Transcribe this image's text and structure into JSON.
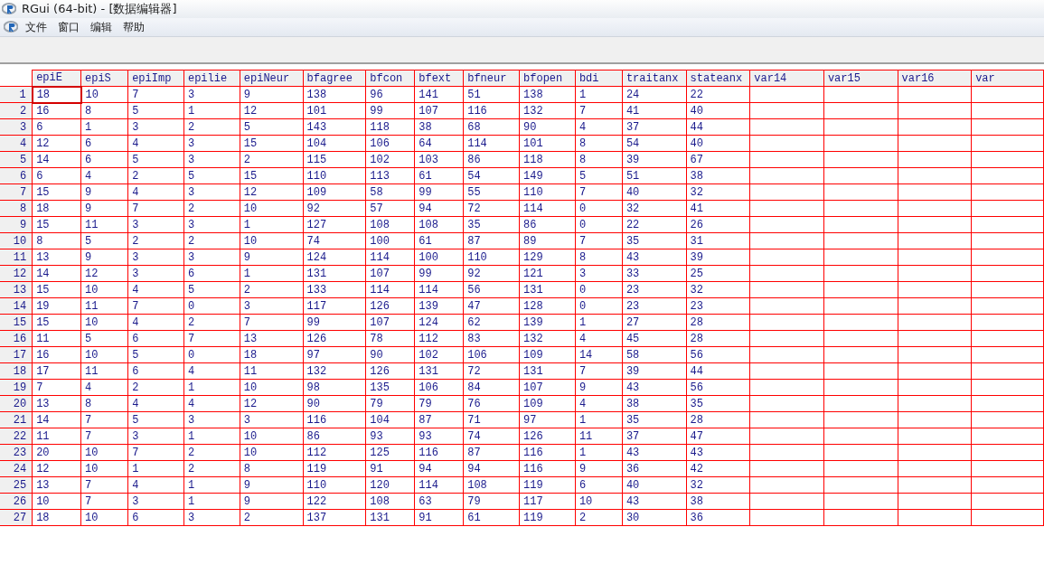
{
  "window": {
    "title": "RGui (64-bit) - [数据编辑器]"
  },
  "menu": [
    "文件",
    "窗口",
    "编辑",
    "帮助"
  ],
  "grid": {
    "columns": [
      "epiE",
      "epiS",
      "epiImp",
      "epilie",
      "epiNeur",
      "bfagree",
      "bfcon",
      "bfext",
      "bfneur",
      "bfopen",
      "bdi",
      "traitanx",
      "stateanx",
      "var14",
      "var15",
      "var16",
      "var"
    ],
    "rows": [
      {
        "label": "1",
        "cells": [
          {
            "value": "18",
            "selected": true
          },
          {
            "value": "10",
            "selected": false
          },
          {
            "value": "7",
            "selected": false
          },
          {
            "value": "3",
            "selected": false
          },
          {
            "value": "9",
            "selected": false
          },
          {
            "value": "138",
            "selected": false
          },
          {
            "value": "96",
            "selected": false
          },
          {
            "value": "141",
            "selected": false
          },
          {
            "value": "51",
            "selected": false
          },
          {
            "value": "138",
            "selected": false
          },
          {
            "value": "1",
            "selected": false
          },
          {
            "value": "24",
            "selected": false
          },
          {
            "value": "22",
            "selected": false
          }
        ]
      },
      {
        "label": "2",
        "cells": [
          {
            "value": "16",
            "selected": false
          },
          {
            "value": "8",
            "selected": false
          },
          {
            "value": "5",
            "selected": false
          },
          {
            "value": "1",
            "selected": false
          },
          {
            "value": "12",
            "selected": false
          },
          {
            "value": "101",
            "selected": false
          },
          {
            "value": "99",
            "selected": false
          },
          {
            "value": "107",
            "selected": false
          },
          {
            "value": "116",
            "selected": false
          },
          {
            "value": "132",
            "selected": false
          },
          {
            "value": "7",
            "selected": false
          },
          {
            "value": "41",
            "selected": false
          },
          {
            "value": "40",
            "selected": false
          }
        ]
      },
      {
        "label": "3",
        "cells": [
          {
            "value": "6",
            "selected": false
          },
          {
            "value": "1",
            "selected": false
          },
          {
            "value": "3",
            "selected": false
          },
          {
            "value": "2",
            "selected": false
          },
          {
            "value": "5",
            "selected": false
          },
          {
            "value": "143",
            "selected": false
          },
          {
            "value": "118",
            "selected": false
          },
          {
            "value": "38",
            "selected": false
          },
          {
            "value": "68",
            "selected": false
          },
          {
            "value": "90",
            "selected": false
          },
          {
            "value": "4",
            "selected": false
          },
          {
            "value": "37",
            "selected": false
          },
          {
            "value": "44",
            "selected": false
          }
        ]
      },
      {
        "label": "4",
        "cells": [
          {
            "value": "12",
            "selected": false
          },
          {
            "value": "6",
            "selected": false
          },
          {
            "value": "4",
            "selected": false
          },
          {
            "value": "3",
            "selected": false
          },
          {
            "value": "15",
            "selected": false
          },
          {
            "value": "104",
            "selected": false
          },
          {
            "value": "106",
            "selected": false
          },
          {
            "value": "64",
            "selected": false
          },
          {
            "value": "114",
            "selected": false
          },
          {
            "value": "101",
            "selected": false
          },
          {
            "value": "8",
            "selected": false
          },
          {
            "value": "54",
            "selected": false
          },
          {
            "value": "40",
            "selected": false
          }
        ]
      },
      {
        "label": "5",
        "cells": [
          {
            "value": "14",
            "selected": false
          },
          {
            "value": "6",
            "selected": false
          },
          {
            "value": "5",
            "selected": false
          },
          {
            "value": "3",
            "selected": false
          },
          {
            "value": "2",
            "selected": false
          },
          {
            "value": "115",
            "selected": false
          },
          {
            "value": "102",
            "selected": false
          },
          {
            "value": "103",
            "selected": false
          },
          {
            "value": "86",
            "selected": false
          },
          {
            "value": "118",
            "selected": false
          },
          {
            "value": "8",
            "selected": false
          },
          {
            "value": "39",
            "selected": false
          },
          {
            "value": "67",
            "selected": false
          }
        ]
      },
      {
        "label": "6",
        "cells": [
          {
            "value": "6",
            "selected": false
          },
          {
            "value": "4",
            "selected": false
          },
          {
            "value": "2",
            "selected": false
          },
          {
            "value": "5",
            "selected": false
          },
          {
            "value": "15",
            "selected": false
          },
          {
            "value": "110",
            "selected": false
          },
          {
            "value": "113",
            "selected": false
          },
          {
            "value": "61",
            "selected": false
          },
          {
            "value": "54",
            "selected": false
          },
          {
            "value": "149",
            "selected": false
          },
          {
            "value": "5",
            "selected": false
          },
          {
            "value": "51",
            "selected": false
          },
          {
            "value": "38",
            "selected": false
          }
        ]
      },
      {
        "label": "7",
        "cells": [
          {
            "value": "15",
            "selected": false
          },
          {
            "value": "9",
            "selected": false
          },
          {
            "value": "4",
            "selected": false
          },
          {
            "value": "3",
            "selected": false
          },
          {
            "value": "12",
            "selected": false
          },
          {
            "value": "109",
            "selected": false
          },
          {
            "value": "58",
            "selected": false
          },
          {
            "value": "99",
            "selected": false
          },
          {
            "value": "55",
            "selected": false
          },
          {
            "value": "110",
            "selected": false
          },
          {
            "value": "7",
            "selected": false
          },
          {
            "value": "40",
            "selected": false
          },
          {
            "value": "32",
            "selected": false
          }
        ]
      },
      {
        "label": "8",
        "cells": [
          {
            "value": "18",
            "selected": false
          },
          {
            "value": "9",
            "selected": false
          },
          {
            "value": "7",
            "selected": false
          },
          {
            "value": "2",
            "selected": false
          },
          {
            "value": "10",
            "selected": false
          },
          {
            "value": "92",
            "selected": false
          },
          {
            "value": "57",
            "selected": false
          },
          {
            "value": "94",
            "selected": false
          },
          {
            "value": "72",
            "selected": false
          },
          {
            "value": "114",
            "selected": false
          },
          {
            "value": "0",
            "selected": false
          },
          {
            "value": "32",
            "selected": false
          },
          {
            "value": "41",
            "selected": false
          }
        ]
      },
      {
        "label": "9",
        "cells": [
          {
            "value": "15",
            "selected": false
          },
          {
            "value": "11",
            "selected": false
          },
          {
            "value": "3",
            "selected": false
          },
          {
            "value": "3",
            "selected": false
          },
          {
            "value": "1",
            "selected": false
          },
          {
            "value": "127",
            "selected": false
          },
          {
            "value": "108",
            "selected": false
          },
          {
            "value": "108",
            "selected": false
          },
          {
            "value": "35",
            "selected": false
          },
          {
            "value": "86",
            "selected": false
          },
          {
            "value": "0",
            "selected": false
          },
          {
            "value": "22",
            "selected": false
          },
          {
            "value": "26",
            "selected": false
          }
        ]
      },
      {
        "label": "10",
        "cells": [
          {
            "value": "8",
            "selected": false
          },
          {
            "value": "5",
            "selected": false
          },
          {
            "value": "2",
            "selected": false
          },
          {
            "value": "2",
            "selected": false
          },
          {
            "value": "10",
            "selected": false
          },
          {
            "value": "74",
            "selected": false
          },
          {
            "value": "100",
            "selected": false
          },
          {
            "value": "61",
            "selected": false
          },
          {
            "value": "87",
            "selected": false
          },
          {
            "value": "89",
            "selected": false
          },
          {
            "value": "7",
            "selected": false
          },
          {
            "value": "35",
            "selected": false
          },
          {
            "value": "31",
            "selected": false
          }
        ]
      },
      {
        "label": "11",
        "cells": [
          {
            "value": "13",
            "selected": false
          },
          {
            "value": "9",
            "selected": false
          },
          {
            "value": "3",
            "selected": false
          },
          {
            "value": "3",
            "selected": false
          },
          {
            "value": "9",
            "selected": false
          },
          {
            "value": "124",
            "selected": false
          },
          {
            "value": "114",
            "selected": false
          },
          {
            "value": "100",
            "selected": false
          },
          {
            "value": "110",
            "selected": false
          },
          {
            "value": "129",
            "selected": false
          },
          {
            "value": "8",
            "selected": false
          },
          {
            "value": "43",
            "selected": false
          },
          {
            "value": "39",
            "selected": false
          }
        ]
      },
      {
        "label": "12",
        "cells": [
          {
            "value": "14",
            "selected": false
          },
          {
            "value": "12",
            "selected": false
          },
          {
            "value": "3",
            "selected": false
          },
          {
            "value": "6",
            "selected": false
          },
          {
            "value": "1",
            "selected": false
          },
          {
            "value": "131",
            "selected": false
          },
          {
            "value": "107",
            "selected": false
          },
          {
            "value": "99",
            "selected": false
          },
          {
            "value": "92",
            "selected": false
          },
          {
            "value": "121",
            "selected": false
          },
          {
            "value": "3",
            "selected": false
          },
          {
            "value": "33",
            "selected": false
          },
          {
            "value": "25",
            "selected": false
          }
        ]
      },
      {
        "label": "13",
        "cells": [
          {
            "value": "15",
            "selected": false
          },
          {
            "value": "10",
            "selected": false
          },
          {
            "value": "4",
            "selected": false
          },
          {
            "value": "5",
            "selected": false
          },
          {
            "value": "2",
            "selected": false
          },
          {
            "value": "133",
            "selected": false
          },
          {
            "value": "114",
            "selected": false
          },
          {
            "value": "114",
            "selected": false
          },
          {
            "value": "56",
            "selected": false
          },
          {
            "value": "131",
            "selected": false
          },
          {
            "value": "0",
            "selected": false
          },
          {
            "value": "23",
            "selected": false
          },
          {
            "value": "32",
            "selected": false
          }
        ]
      },
      {
        "label": "14",
        "cells": [
          {
            "value": "19",
            "selected": false
          },
          {
            "value": "11",
            "selected": false
          },
          {
            "value": "7",
            "selected": false
          },
          {
            "value": "0",
            "selected": false
          },
          {
            "value": "3",
            "selected": false
          },
          {
            "value": "117",
            "selected": false
          },
          {
            "value": "126",
            "selected": false
          },
          {
            "value": "139",
            "selected": false
          },
          {
            "value": "47",
            "selected": false
          },
          {
            "value": "128",
            "selected": false
          },
          {
            "value": "0",
            "selected": false
          },
          {
            "value": "23",
            "selected": false
          },
          {
            "value": "23",
            "selected": false
          }
        ]
      },
      {
        "label": "15",
        "cells": [
          {
            "value": "15",
            "selected": false
          },
          {
            "value": "10",
            "selected": false
          },
          {
            "value": "4",
            "selected": false
          },
          {
            "value": "2",
            "selected": false
          },
          {
            "value": "7",
            "selected": false
          },
          {
            "value": "99",
            "selected": false
          },
          {
            "value": "107",
            "selected": false
          },
          {
            "value": "124",
            "selected": false
          },
          {
            "value": "62",
            "selected": false
          },
          {
            "value": "139",
            "selected": false
          },
          {
            "value": "1",
            "selected": false
          },
          {
            "value": "27",
            "selected": false
          },
          {
            "value": "28",
            "selected": false
          }
        ]
      },
      {
        "label": "16",
        "cells": [
          {
            "value": "11",
            "selected": false
          },
          {
            "value": "5",
            "selected": false
          },
          {
            "value": "6",
            "selected": false
          },
          {
            "value": "7",
            "selected": false
          },
          {
            "value": "13",
            "selected": false
          },
          {
            "value": "126",
            "selected": false
          },
          {
            "value": "78",
            "selected": false
          },
          {
            "value": "112",
            "selected": false
          },
          {
            "value": "83",
            "selected": false
          },
          {
            "value": "132",
            "selected": false
          },
          {
            "value": "4",
            "selected": false
          },
          {
            "value": "45",
            "selected": false
          },
          {
            "value": "28",
            "selected": false
          }
        ]
      },
      {
        "label": "17",
        "cells": [
          {
            "value": "16",
            "selected": false
          },
          {
            "value": "10",
            "selected": false
          },
          {
            "value": "5",
            "selected": false
          },
          {
            "value": "0",
            "selected": false
          },
          {
            "value": "18",
            "selected": false
          },
          {
            "value": "97",
            "selected": false
          },
          {
            "value": "90",
            "selected": false
          },
          {
            "value": "102",
            "selected": false
          },
          {
            "value": "106",
            "selected": false
          },
          {
            "value": "109",
            "selected": false
          },
          {
            "value": "14",
            "selected": false
          },
          {
            "value": "58",
            "selected": false
          },
          {
            "value": "56",
            "selected": false
          }
        ]
      },
      {
        "label": "18",
        "cells": [
          {
            "value": "17",
            "selected": false
          },
          {
            "value": "11",
            "selected": false
          },
          {
            "value": "6",
            "selected": false
          },
          {
            "value": "4",
            "selected": false
          },
          {
            "value": "11",
            "selected": false
          },
          {
            "value": "132",
            "selected": false
          },
          {
            "value": "126",
            "selected": false
          },
          {
            "value": "131",
            "selected": false
          },
          {
            "value": "72",
            "selected": false
          },
          {
            "value": "131",
            "selected": false
          },
          {
            "value": "7",
            "selected": false
          },
          {
            "value": "39",
            "selected": false
          },
          {
            "value": "44",
            "selected": false
          }
        ]
      },
      {
        "label": "19",
        "cells": [
          {
            "value": "7",
            "selected": false
          },
          {
            "value": "4",
            "selected": false
          },
          {
            "value": "2",
            "selected": false
          },
          {
            "value": "1",
            "selected": false
          },
          {
            "value": "10",
            "selected": false
          },
          {
            "value": "98",
            "selected": false
          },
          {
            "value": "135",
            "selected": false
          },
          {
            "value": "106",
            "selected": false
          },
          {
            "value": "84",
            "selected": false
          },
          {
            "value": "107",
            "selected": false
          },
          {
            "value": "9",
            "selected": false
          },
          {
            "value": "43",
            "selected": false
          },
          {
            "value": "56",
            "selected": false
          }
        ]
      },
      {
        "label": "20",
        "cells": [
          {
            "value": "13",
            "selected": false
          },
          {
            "value": "8",
            "selected": false
          },
          {
            "value": "4",
            "selected": false
          },
          {
            "value": "4",
            "selected": false
          },
          {
            "value": "12",
            "selected": false
          },
          {
            "value": "90",
            "selected": false
          },
          {
            "value": "79",
            "selected": false
          },
          {
            "value": "79",
            "selected": false
          },
          {
            "value": "76",
            "selected": false
          },
          {
            "value": "109",
            "selected": false
          },
          {
            "value": "4",
            "selected": false
          },
          {
            "value": "38",
            "selected": false
          },
          {
            "value": "35",
            "selected": false
          }
        ]
      },
      {
        "label": "21",
        "cells": [
          {
            "value": "14",
            "selected": false
          },
          {
            "value": "7",
            "selected": false
          },
          {
            "value": "5",
            "selected": false
          },
          {
            "value": "3",
            "selected": false
          },
          {
            "value": "3",
            "selected": false
          },
          {
            "value": "116",
            "selected": false
          },
          {
            "value": "104",
            "selected": false
          },
          {
            "value": "87",
            "selected": false
          },
          {
            "value": "71",
            "selected": false
          },
          {
            "value": "97",
            "selected": false
          },
          {
            "value": "1",
            "selected": false
          },
          {
            "value": "35",
            "selected": false
          },
          {
            "value": "28",
            "selected": false
          }
        ]
      },
      {
        "label": "22",
        "cells": [
          {
            "value": "11",
            "selected": false
          },
          {
            "value": "7",
            "selected": false
          },
          {
            "value": "3",
            "selected": false
          },
          {
            "value": "1",
            "selected": false
          },
          {
            "value": "10",
            "selected": false
          },
          {
            "value": "86",
            "selected": false
          },
          {
            "value": "93",
            "selected": false
          },
          {
            "value": "93",
            "selected": false
          },
          {
            "value": "74",
            "selected": false
          },
          {
            "value": "126",
            "selected": false
          },
          {
            "value": "11",
            "selected": false
          },
          {
            "value": "37",
            "selected": false
          },
          {
            "value": "47",
            "selected": false
          }
        ]
      },
      {
        "label": "23",
        "cells": [
          {
            "value": "20",
            "selected": false
          },
          {
            "value": "10",
            "selected": false
          },
          {
            "value": "7",
            "selected": false
          },
          {
            "value": "2",
            "selected": false
          },
          {
            "value": "10",
            "selected": false
          },
          {
            "value": "112",
            "selected": false
          },
          {
            "value": "125",
            "selected": false
          },
          {
            "value": "116",
            "selected": false
          },
          {
            "value": "87",
            "selected": false
          },
          {
            "value": "116",
            "selected": false
          },
          {
            "value": "1",
            "selected": false
          },
          {
            "value": "43",
            "selected": false
          },
          {
            "value": "43",
            "selected": false
          }
        ]
      },
      {
        "label": "24",
        "cells": [
          {
            "value": "12",
            "selected": false
          },
          {
            "value": "10",
            "selected": false
          },
          {
            "value": "1",
            "selected": false
          },
          {
            "value": "2",
            "selected": false
          },
          {
            "value": "8",
            "selected": false
          },
          {
            "value": "119",
            "selected": false
          },
          {
            "value": "91",
            "selected": false
          },
          {
            "value": "94",
            "selected": false
          },
          {
            "value": "94",
            "selected": false
          },
          {
            "value": "116",
            "selected": false
          },
          {
            "value": "9",
            "selected": false
          },
          {
            "value": "36",
            "selected": false
          },
          {
            "value": "42",
            "selected": false
          }
        ]
      },
      {
        "label": "25",
        "cells": [
          {
            "value": "13",
            "selected": false
          },
          {
            "value": "7",
            "selected": false
          },
          {
            "value": "4",
            "selected": false
          },
          {
            "value": "1",
            "selected": false
          },
          {
            "value": "9",
            "selected": false
          },
          {
            "value": "110",
            "selected": false
          },
          {
            "value": "120",
            "selected": false
          },
          {
            "value": "114",
            "selected": false
          },
          {
            "value": "108",
            "selected": false
          },
          {
            "value": "119",
            "selected": false
          },
          {
            "value": "6",
            "selected": false
          },
          {
            "value": "40",
            "selected": false
          },
          {
            "value": "32",
            "selected": false
          }
        ]
      },
      {
        "label": "26",
        "cells": [
          {
            "value": "10",
            "selected": false
          },
          {
            "value": "7",
            "selected": false
          },
          {
            "value": "3",
            "selected": false
          },
          {
            "value": "1",
            "selected": false
          },
          {
            "value": "9",
            "selected": false
          },
          {
            "value": "122",
            "selected": false
          },
          {
            "value": "108",
            "selected": false
          },
          {
            "value": "63",
            "selected": false
          },
          {
            "value": "79",
            "selected": false
          },
          {
            "value": "117",
            "selected": false
          },
          {
            "value": "10",
            "selected": false
          },
          {
            "value": "43",
            "selected": false
          },
          {
            "value": "38",
            "selected": false
          }
        ]
      },
      {
        "label": "27",
        "cells": [
          {
            "value": "18",
            "selected": false
          },
          {
            "value": "10",
            "selected": false
          },
          {
            "value": "6",
            "selected": false
          },
          {
            "value": "3",
            "selected": false
          },
          {
            "value": "2",
            "selected": false
          },
          {
            "value": "137",
            "selected": false
          },
          {
            "value": "131",
            "selected": false
          },
          {
            "value": "91",
            "selected": false
          },
          {
            "value": "61",
            "selected": false
          },
          {
            "value": "119",
            "selected": false
          },
          {
            "value": "2",
            "selected": false
          },
          {
            "value": "30",
            "selected": false
          },
          {
            "value": "36",
            "selected": false
          }
        ]
      }
    ]
  }
}
